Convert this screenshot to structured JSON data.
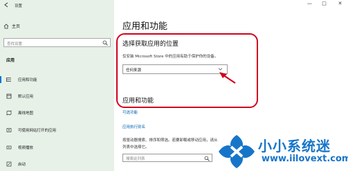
{
  "window": {
    "title": "设置",
    "controls": [
      "—",
      "□",
      "✕"
    ]
  },
  "sidebar": {
    "home_label": "主页",
    "search_placeholder": "查找设置",
    "section_label": "应用",
    "items": [
      {
        "label": "应用和功能",
        "icon": "list-icon",
        "selected": true
      },
      {
        "label": "默认应用",
        "icon": "default-apps-icon"
      },
      {
        "label": "离线地图",
        "icon": "map-icon"
      },
      {
        "label": "可使用网站打开的应用",
        "icon": "open-in-browser-icon"
      },
      {
        "label": "视频播放",
        "icon": "video-icon"
      },
      {
        "label": "启动",
        "icon": "startup-icon"
      }
    ]
  },
  "main": {
    "title": "应用和功能",
    "choose_heading": "选择获取应用的位置",
    "choose_desc": "仅安装 Microsoft Store 中的应用有助于保护你的设备。",
    "dropdown_value": "任何来源",
    "apps_heading": "应用和功能",
    "link_optional": "可选功能",
    "link_alias": "应用执行别名",
    "body_text": "按驱动器搜索、排序和筛选。若要卸载或移动应用，请从列表中选择它。",
    "search_placeholder": "搜索此列表"
  },
  "watermark": {
    "title": "小小系统迷",
    "url": "www.iilovext.com"
  },
  "colors": {
    "sidebar_bg": "#e7f1e8",
    "accent": "#0078d7",
    "link": "#0063b1",
    "callout": "#d0021b",
    "watermark": "#1775c9"
  }
}
